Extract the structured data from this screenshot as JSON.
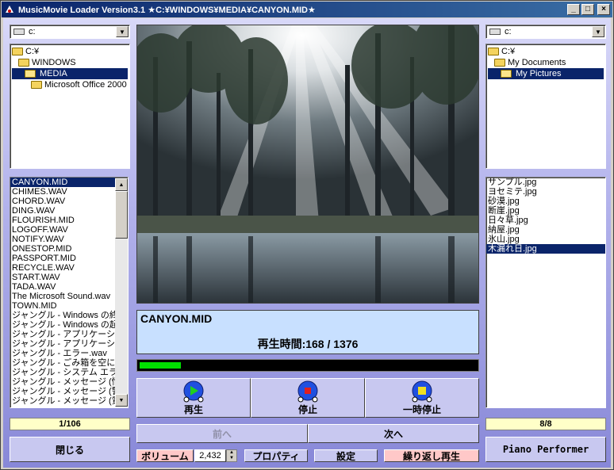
{
  "window": {
    "title": "MusicMovie Loader Version3.1 ★C:¥WINDOWS¥MEDIA¥CANYON.MID★",
    "minimize": "_",
    "maximize": "□",
    "close": "×"
  },
  "left": {
    "drive": "c:",
    "tree": [
      {
        "label": "C:¥",
        "indent": 0,
        "selected": false
      },
      {
        "label": "WINDOWS",
        "indent": 1,
        "selected": false
      },
      {
        "label": "MEDIA",
        "indent": 2,
        "selected": true
      },
      {
        "label": "Microsoft Office 2000",
        "indent": 3,
        "selected": false
      }
    ],
    "files": [
      "CANYON.MID",
      "CHIMES.WAV",
      "CHORD.WAV",
      "DING.WAV",
      "FLOURISH.MID",
      "LOGOFF.WAV",
      "NOTIFY.WAV",
      "ONESTOP.MID",
      "PASSPORT.MID",
      "RECYCLE.WAV",
      "START.WAV",
      "TADA.WAV",
      "The Microsoft Sound.wav",
      "TOWN.MID",
      "ジャングル - Windows の終了.wav",
      "ジャングル - Windows の起動.wav",
      "ジャングル - アプリケーションの終了.wav",
      "ジャングル - アプリケーションの起動.wav",
      "ジャングル - エラー.wav",
      "ジャングル - ごみ箱を空にする.wav",
      "ジャングル - システム エラー.wav",
      "ジャングル - メッセージ (情報).wav",
      "ジャングル - メッセージ (警告).wav",
      "ジャングル - メッセージ (質問).wav"
    ],
    "selected_file_index": 0,
    "counter": "1/106",
    "close_button": "閉じる"
  },
  "right": {
    "drive": "c:",
    "tree": [
      {
        "label": "C:¥",
        "indent": 0,
        "selected": false
      },
      {
        "label": "My Documents",
        "indent": 1,
        "selected": false
      },
      {
        "label": "My Pictures",
        "indent": 2,
        "selected": true
      }
    ],
    "files": [
      "サンプル.jpg",
      "ヨセミテ.jpg",
      "砂漠.jpg",
      "断崖.jpg",
      "日々草.jpg",
      "納屋.jpg",
      "氷山.jpg",
      "木漏れ日.jpg"
    ],
    "selected_file_index": 7,
    "counter": "8/8",
    "piano_button": "Piano Performer"
  },
  "player": {
    "filename": "CANYON.MID",
    "time_text": "再生時間:168 / 1376",
    "progress_fraction": 0.122,
    "play": "再生",
    "stop": "停止",
    "pause": "一時停止",
    "prev": "前へ",
    "next": "次へ"
  },
  "bottom": {
    "volume_label": "ボリューム",
    "volume_value": "2,432",
    "properties": "プロパティ",
    "settings": "設定",
    "repeat": "繰り返し再生"
  }
}
